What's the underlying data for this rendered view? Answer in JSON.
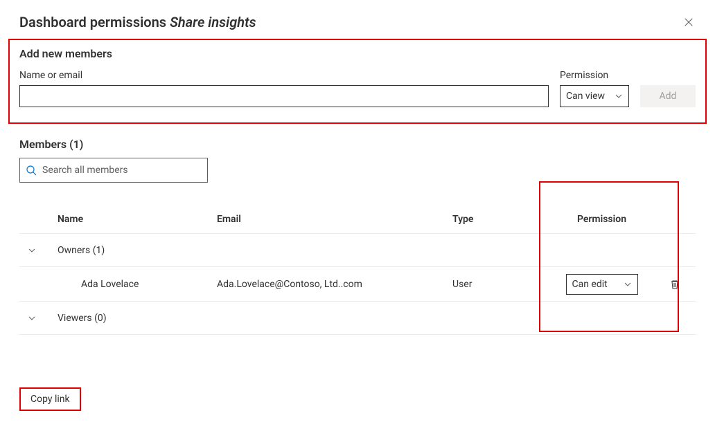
{
  "header": {
    "title_prefix": "Dashboard permissions ",
    "title_suffix": "Share insights"
  },
  "add_section": {
    "heading": "Add new members",
    "name_label": "Name or email",
    "perm_label": "Permission",
    "perm_value": "Can view",
    "add_button": "Add"
  },
  "members_header": "Members (1)",
  "search_placeholder": "Search all members",
  "columns": {
    "name": "Name",
    "email": "Email",
    "type": "Type",
    "permission": "Permission"
  },
  "groups": {
    "owners": {
      "label": "Owners (1)"
    },
    "viewers": {
      "label": "Viewers (0)"
    }
  },
  "rows": [
    {
      "name": "Ada Lovelace",
      "email": "Ada.Lovelace@Contoso, Ltd..com",
      "type": "User",
      "permission": "Can edit"
    }
  ],
  "copy_link": "Copy link"
}
